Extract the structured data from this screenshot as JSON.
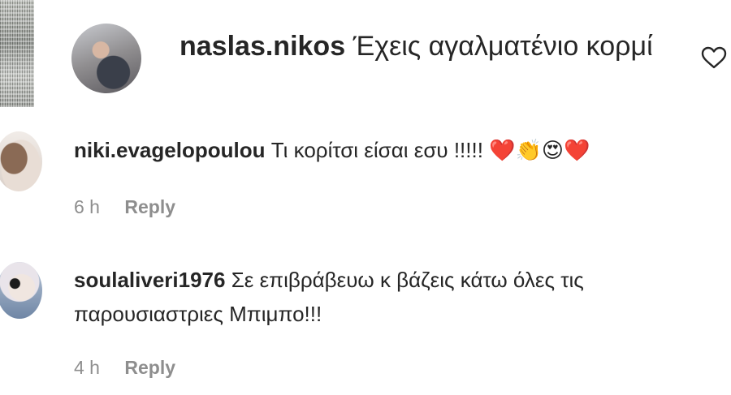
{
  "comments": [
    {
      "username": "naslas.nikos",
      "text": "Έχεις αγαλματένιο κορμί"
    },
    {
      "username": "niki.evagelopoulou",
      "text": "Τι κορίτσι είσαι εσυ !!!!!",
      "emojis": "❤️👏😍❤️",
      "time": "6 h",
      "reply_label": "Reply"
    },
    {
      "username": "soulaliveri1976",
      "text": "Σε επιβράβευω κ βάζεις κάτω όλες τις παρουσιαστριες Μπιμπο!!!",
      "time": "4 h",
      "reply_label": "Reply"
    }
  ],
  "icons": {
    "like": "heart-outline-icon"
  }
}
